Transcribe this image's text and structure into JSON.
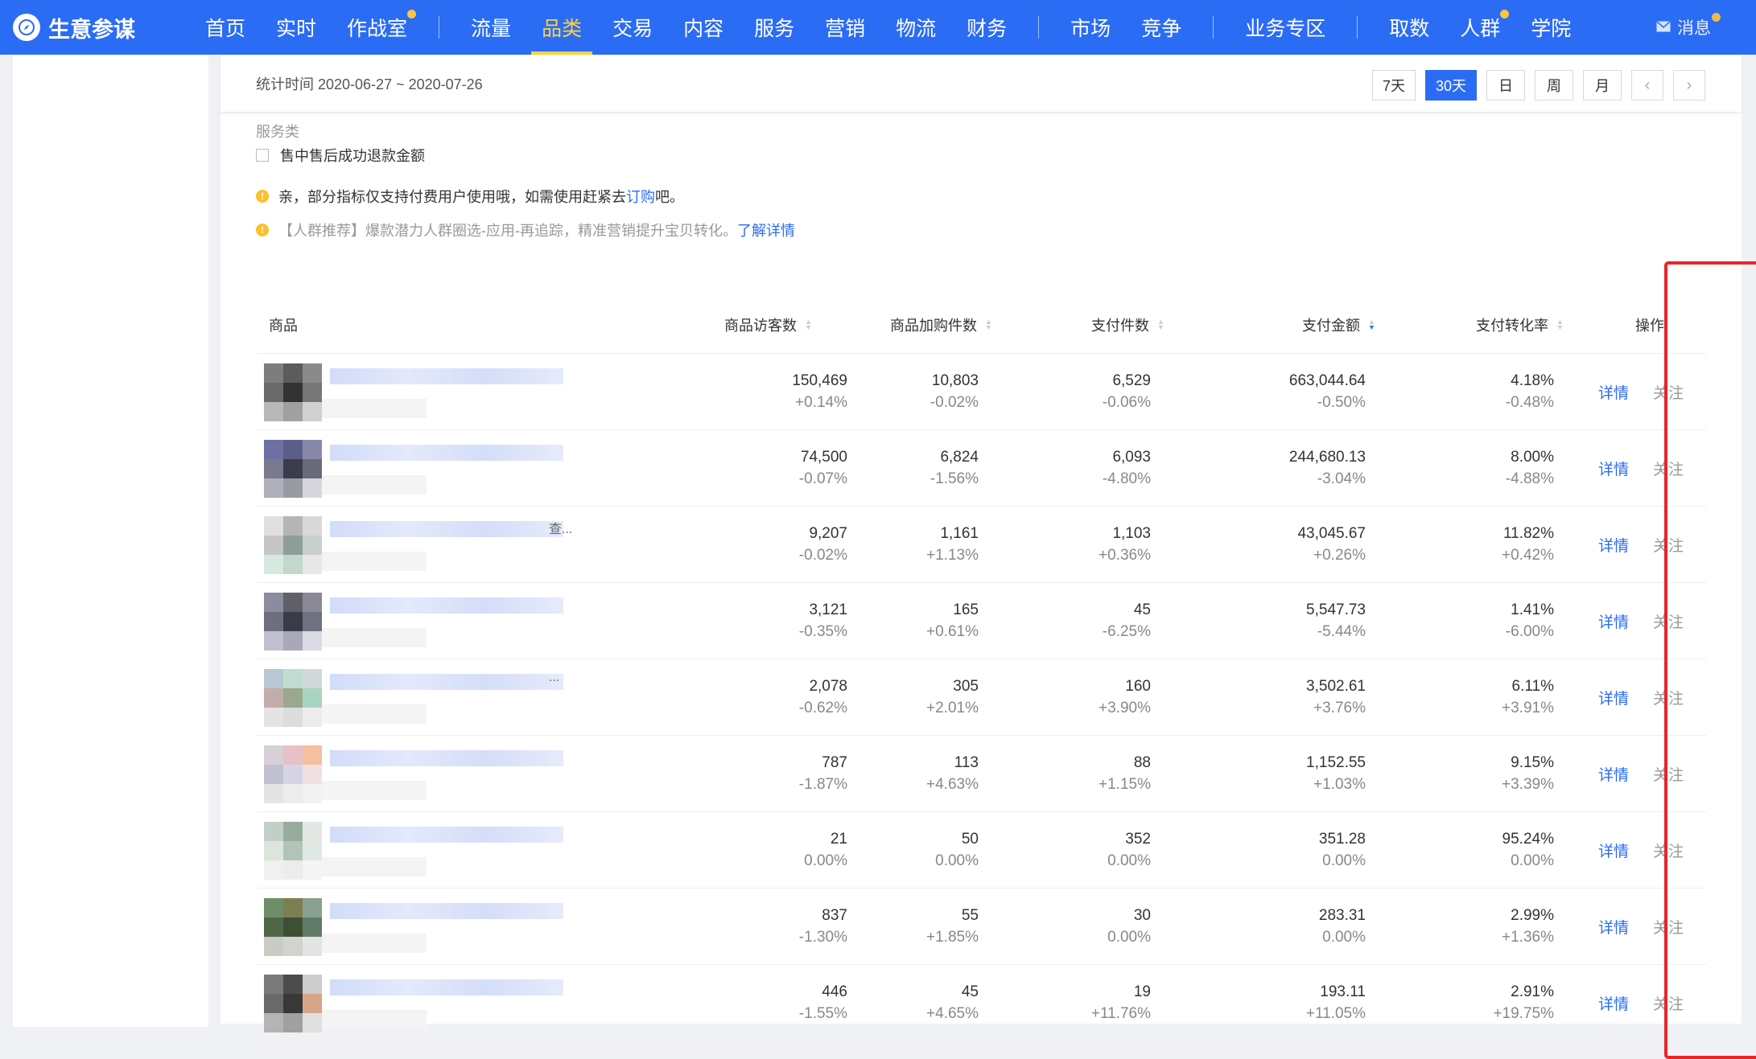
{
  "header": {
    "logo_text": "生意参谋",
    "menu": [
      {
        "label": "首页",
        "active": false,
        "dot": false
      },
      {
        "label": "实时",
        "active": false,
        "dot": false
      },
      {
        "label": "作战室",
        "active": false,
        "dot": true
      },
      {
        "label": "流量",
        "active": false,
        "dot": false,
        "sep_before": true
      },
      {
        "label": "品类",
        "active": true,
        "dot": false
      },
      {
        "label": "交易",
        "active": false,
        "dot": false
      },
      {
        "label": "内容",
        "active": false,
        "dot": false
      },
      {
        "label": "服务",
        "active": false,
        "dot": false
      },
      {
        "label": "营销",
        "active": false,
        "dot": false
      },
      {
        "label": "物流",
        "active": false,
        "dot": false
      },
      {
        "label": "财务",
        "active": false,
        "dot": false
      },
      {
        "label": "市场",
        "active": false,
        "dot": false,
        "sep_before": true
      },
      {
        "label": "竞争",
        "active": false,
        "dot": false
      },
      {
        "label": "业务专区",
        "active": false,
        "dot": false,
        "sep_before": true
      },
      {
        "label": "取数",
        "active": false,
        "dot": false,
        "sep_before": true
      },
      {
        "label": "人群",
        "active": false,
        "dot": true
      },
      {
        "label": "学院",
        "active": false,
        "dot": false
      }
    ],
    "message_label": "消息",
    "accent_color": "#2b6cf5",
    "active_color": "#ffd23c"
  },
  "date_bar": {
    "range_text": "统计时间 2020-06-27 ~ 2020-07-26",
    "buttons": [
      {
        "label": "7天",
        "active": false
      },
      {
        "label": "30天",
        "active": true
      },
      {
        "label": "日",
        "active": false
      },
      {
        "label": "周",
        "active": false
      },
      {
        "label": "月",
        "active": false
      }
    ]
  },
  "filters": {
    "group_label": "服务类",
    "checkbox_label": "售中售后成功退款金额"
  },
  "notices": {
    "first_text": "亲，部分指标仅支持付费用户使用哦，如需使用赶紧去",
    "first_link": "订购",
    "first_suffix": "吧。",
    "second_text": "【人群推荐】爆款潜力人群圈选-应用-再追踪，精准营销提升宝贝转化。",
    "second_link": "了解详情"
  },
  "table": {
    "columns": {
      "product": "商品",
      "visitors": "商品访客数",
      "cart": "商品加购件数",
      "pay_qty": "支付件数",
      "pay_amount": "支付金额",
      "conversion": "支付转化率",
      "action": "操作"
    },
    "sorted_column": "pay_amount",
    "detail_label": "详情",
    "follow_label": "关注",
    "rows": [
      {
        "visitors": "150,469",
        "visitors_chg": "+0.14%",
        "cart": "10,803",
        "cart_chg": "-0.02%",
        "pay_qty": "6,529",
        "pay_qty_chg": "-0.06%",
        "amount": "663,044.64",
        "amount_chg": "-0.50%",
        "conv": "4.18%",
        "conv_chg": "-0.48%",
        "title_tail": "",
        "thumb": [
          "#7d7d7d",
          "#5c5c5c",
          "#8a8a8a",
          "#6a6a6a",
          "#333333",
          "#777777",
          "#b8b8b8",
          "#a0a0a0",
          "#d0d0d0"
        ]
      },
      {
        "visitors": "74,500",
        "visitors_chg": "-0.07%",
        "cart": "6,824",
        "cart_chg": "-1.56%",
        "pay_qty": "6,093",
        "pay_qty_chg": "-4.80%",
        "amount": "244,680.13",
        "amount_chg": "-3.04%",
        "conv": "8.00%",
        "conv_chg": "-4.88%",
        "title_tail": "",
        "thumb": [
          "#6e6fa3",
          "#5c5e8a",
          "#8888aa",
          "#7a7a8e",
          "#3c3c4c",
          "#6a6a7a",
          "#b0b0bb",
          "#9a9aa5",
          "#d6d6dc"
        ]
      },
      {
        "visitors": "9,207",
        "visitors_chg": "-0.02%",
        "cart": "1,161",
        "cart_chg": "+1.13%",
        "pay_qty": "1,103",
        "pay_qty_chg": "+0.36%",
        "amount": "43,045.67",
        "amount_chg": "+0.26%",
        "conv": "11.82%",
        "conv_chg": "+0.42%",
        "title_tail": "查...",
        "thumb": [
          "#e0e0e0",
          "#b5b5b5",
          "#d8d8d8",
          "#c6c6c6",
          "#8e9e98",
          "#c8d0cc",
          "#d6e8e0",
          "#c2d8cc",
          "#e8e8e8"
        ]
      },
      {
        "visitors": "3,121",
        "visitors_chg": "-0.35%",
        "cart": "165",
        "cart_chg": "+0.61%",
        "pay_qty": "45",
        "pay_qty_chg": "-6.25%",
        "amount": "5,547.73",
        "amount_chg": "-5.44%",
        "conv": "1.41%",
        "conv_chg": "-6.00%",
        "title_tail": "",
        "thumb": [
          "#8c8ca0",
          "#606068",
          "#8a8a96",
          "#6e6e80",
          "#3a3a48",
          "#707080",
          "#c0c0d0",
          "#a8a8b8",
          "#dadae4"
        ]
      },
      {
        "visitors": "2,078",
        "visitors_chg": "-0.62%",
        "cart": "305",
        "cart_chg": "+2.01%",
        "pay_qty": "160",
        "pay_qty_chg": "+3.90%",
        "amount": "3,502.61",
        "amount_chg": "+3.76%",
        "conv": "6.11%",
        "conv_chg": "+3.91%",
        "title_tail": "...",
        "thumb": [
          "#b8c8d4",
          "#c0dcd0",
          "#d0d8d8",
          "#c4aca8",
          "#9aa890",
          "#a8d4c0",
          "#e4e4e4",
          "#dcdcdc",
          "#ececec"
        ]
      },
      {
        "visitors": "787",
        "visitors_chg": "-1.87%",
        "cart": "113",
        "cart_chg": "+4.63%",
        "pay_qty": "88",
        "pay_qty_chg": "+1.15%",
        "amount": "1,152.55",
        "amount_chg": "+1.03%",
        "conv": "9.15%",
        "conv_chg": "+3.39%",
        "title_tail": "",
        "thumb": [
          "#d8d0d8",
          "#e8c0c8",
          "#f4c0a0",
          "#c0c0d0",
          "#d4d4e4",
          "#f0e0e0",
          "#e4e4e4",
          "#ececec",
          "#f2f2f2"
        ]
      },
      {
        "visitors": "21",
        "visitors_chg": "0.00%",
        "cart": "50",
        "cart_chg": "0.00%",
        "pay_qty": "352",
        "pay_qty_chg": "0.00%",
        "amount": "351.28",
        "amount_chg": "0.00%",
        "conv": "95.24%",
        "conv_chg": "0.00%",
        "title_tail": "",
        "thumb": [
          "#c0d0c8",
          "#98ac9c",
          "#e4e8e4",
          "#dce4dc",
          "#b0c4b8",
          "#e0e8e4",
          "#f0f0f0",
          "#ececec",
          "#f4f4f4"
        ]
      },
      {
        "visitors": "837",
        "visitors_chg": "-1.30%",
        "cart": "55",
        "cart_chg": "+1.85%",
        "pay_qty": "30",
        "pay_qty_chg": "0.00%",
        "amount": "283.31",
        "amount_chg": "0.00%",
        "conv": "2.99%",
        "conv_chg": "+1.36%",
        "title_tail": "",
        "thumb": [
          "#6e8e6a",
          "#7c8050",
          "#8aa090",
          "#506848",
          "#3e5034",
          "#607c68",
          "#c8ccc4",
          "#d0d4cc",
          "#e4e4e4"
        ]
      },
      {
        "visitors": "446",
        "visitors_chg": "-1.55%",
        "cart": "45",
        "cart_chg": "+4.65%",
        "pay_qty": "19",
        "pay_qty_chg": "+11.76%",
        "amount": "193.11",
        "amount_chg": "+11.05%",
        "conv": "2.91%",
        "conv_chg": "+19.75%",
        "title_tail": "",
        "thumb": [
          "#7a7a7a",
          "#4c4c4c",
          "#cccccc",
          "#6a6a6a",
          "#383838",
          "#d8a488",
          "#b4b4b4",
          "#a0a0a0",
          "#e0e0e0"
        ]
      }
    ]
  },
  "highlight_color": "#e8262a"
}
